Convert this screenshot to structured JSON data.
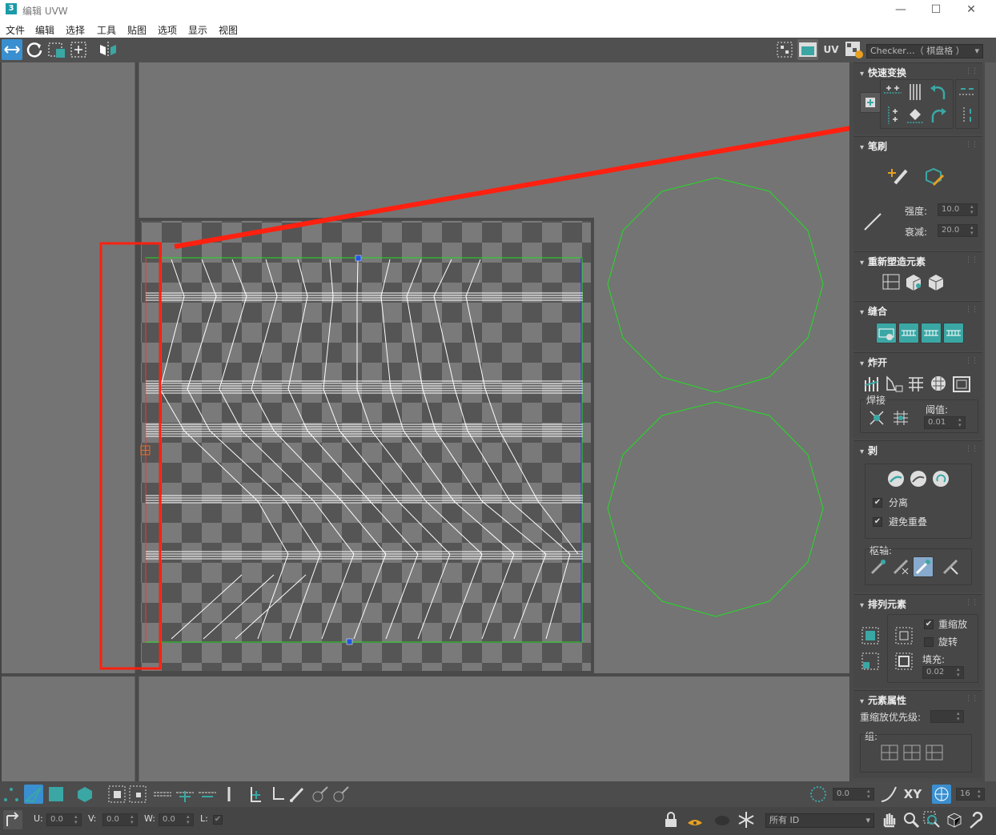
{
  "window": {
    "title": "编辑 UVW",
    "app_icon": "3",
    "minimize": "—",
    "maximize": "☐",
    "close": "✕"
  },
  "menu": [
    "文件",
    "编辑",
    "选择",
    "工具",
    "贴图",
    "选项",
    "显示",
    "视图"
  ],
  "toolbar": {
    "uv_label": "UV",
    "texture_select": "Checker…（ 棋盘格 ）"
  },
  "panel": {
    "quick_transform": {
      "title": "快速变换"
    },
    "brush": {
      "title": "笔刷",
      "strength_label": "强度:",
      "strength_value": "10.0",
      "falloff_label": "衰减:",
      "falloff_value": "20.0"
    },
    "reshape": {
      "title": "重新塑造元素"
    },
    "stitch": {
      "title": "缝合"
    },
    "explode": {
      "title": "炸开",
      "weld_label": "焊接",
      "threshold_label": "阈值:",
      "threshold_value": "0.01"
    },
    "peel": {
      "title": "剥",
      "detach_label": "分离",
      "avoid_overlap_label": "避免重叠",
      "pivot_label": "枢轴:"
    },
    "arrange": {
      "title": "排列元素",
      "rescale_label": "重缩放",
      "rotate_label": "旋转",
      "padding_label": "填充:",
      "padding_value": "0.02"
    },
    "element_props": {
      "title": "元素属性",
      "priority_label": "重缩放优先级:",
      "groups_label": "组:"
    }
  },
  "status": {
    "angle_value": "0.0",
    "xy_label": "XY",
    "grid_value": "16",
    "u_label": "U:",
    "u_value": "0.0",
    "v_label": "V:",
    "v_value": "0.0",
    "w_label": "W:",
    "w_value": "0.0",
    "l_label": "L:",
    "id_filter": "所有 ID"
  },
  "colors": {
    "accent": "#3aa7a5",
    "annotation": "#ff2010",
    "uv_wire": "#ffffff",
    "boundary": "#22dd22"
  }
}
